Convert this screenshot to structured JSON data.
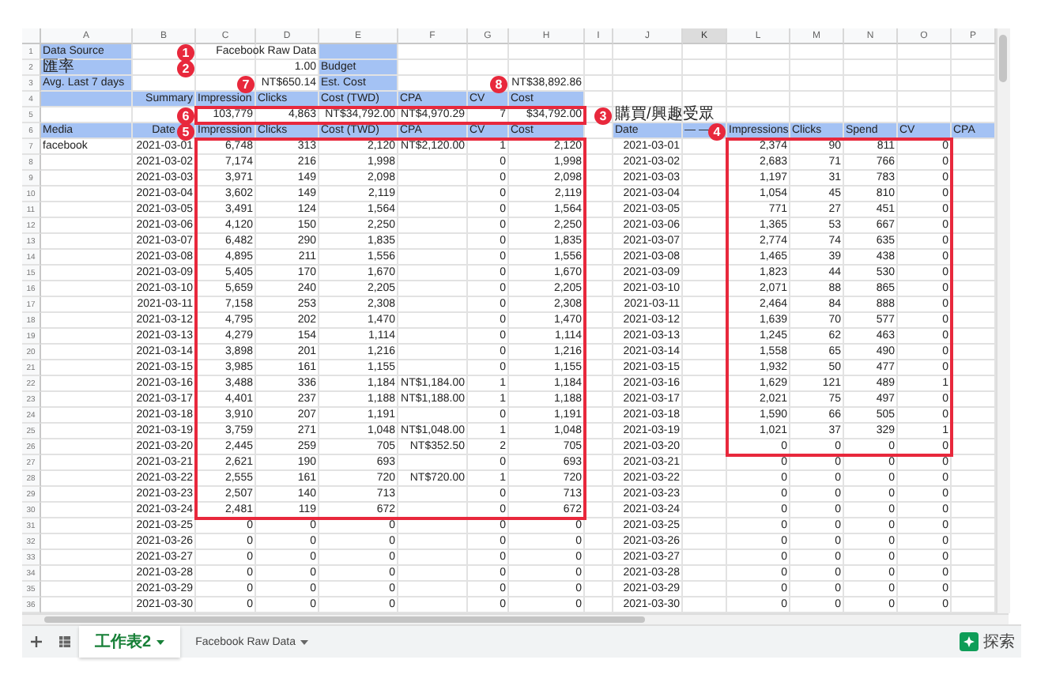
{
  "columns": [
    {
      "label": "A",
      "selected": false
    },
    {
      "label": "B",
      "selected": false
    },
    {
      "label": "C",
      "selected": false
    },
    {
      "label": "D",
      "selected": false
    },
    {
      "label": "E",
      "selected": false
    },
    {
      "label": "F",
      "selected": false
    },
    {
      "label": "G",
      "selected": false
    },
    {
      "label": "H",
      "selected": false
    },
    {
      "label": "I",
      "selected": false
    },
    {
      "label": "J",
      "selected": false
    },
    {
      "label": "K",
      "selected": true
    },
    {
      "label": "L",
      "selected": false
    },
    {
      "label": "M",
      "selected": false
    },
    {
      "label": "N",
      "selected": false
    },
    {
      "label": "O",
      "selected": false
    },
    {
      "label": "P",
      "selected": false
    }
  ],
  "rows": [
    {
      "number": "1",
      "kind": "label",
      "cells": {
        "A": "Data Source",
        "D": "Facebook Raw Data"
      }
    },
    {
      "number": "2",
      "kind": "label",
      "cells": {
        "A": "匯率",
        "D": "1.00",
        "E": "Budget"
      }
    },
    {
      "number": "3",
      "kind": "label",
      "cells": {
        "A": "Avg. Last 7 days",
        "D": "NT$650.14",
        "E": "Est. Cost",
        "H": "NT$38,892.86"
      }
    },
    {
      "number": "4",
      "kind": "summary",
      "cells": {
        "B": "Summary",
        "C": "Impression",
        "D": "Clicks",
        "E": "Cost (TWD)",
        "F": "CPA",
        "G": "CV",
        "H": "Cost"
      }
    },
    {
      "number": "5",
      "kind": "totals",
      "cells": {
        "C": "103,779",
        "D": "4,863",
        "E": "NT$34,792.00",
        "F": "NT$4,970.29",
        "G": "7",
        "H": "$34,792.00",
        "J": "購買/興趣受眾"
      }
    },
    {
      "number": "6",
      "kind": "header",
      "cells": {
        "A": "Media",
        "B": "Date",
        "C": "Impression",
        "D": "Clicks",
        "E": "Cost (TWD)",
        "F": "CPA",
        "G": "CV",
        "H": "Cost",
        "J": "Date",
        "K": "— —",
        "L": "Impressions",
        "M": "Clicks",
        "N": "Spend",
        "O": "CV",
        "P": "CPA"
      }
    },
    {
      "number": "7",
      "kind": "data",
      "cells": {
        "A": "facebook",
        "B": "2021-03-01",
        "C": "6,748",
        "D": "313",
        "E": "2,120",
        "F": "NT$2,120.00",
        "G": "1",
        "H": "2,120",
        "J": "2021-03-01",
        "L": "2,374",
        "M": "90",
        "N": "811",
        "O": "0"
      }
    },
    {
      "number": "8",
      "kind": "data",
      "cells": {
        "B": "2021-03-02",
        "C": "7,174",
        "D": "216",
        "E": "1,998",
        "G": "0",
        "H": "1,998",
        "J": "2021-03-02",
        "L": "2,683",
        "M": "71",
        "N": "766",
        "O": "0"
      }
    },
    {
      "number": "9",
      "kind": "data",
      "cells": {
        "B": "2021-03-03",
        "C": "3,971",
        "D": "149",
        "E": "2,098",
        "G": "0",
        "H": "2,098",
        "J": "2021-03-03",
        "L": "1,197",
        "M": "31",
        "N": "783",
        "O": "0"
      }
    },
    {
      "number": "10",
      "kind": "data",
      "cells": {
        "B": "2021-03-04",
        "C": "3,602",
        "D": "149",
        "E": "2,119",
        "G": "0",
        "H": "2,119",
        "J": "2021-03-04",
        "L": "1,054",
        "M": "45",
        "N": "810",
        "O": "0"
      }
    },
    {
      "number": "11",
      "kind": "data",
      "cells": {
        "B": "2021-03-05",
        "C": "3,491",
        "D": "124",
        "E": "1,564",
        "G": "0",
        "H": "1,564",
        "J": "2021-03-05",
        "L": "771",
        "M": "27",
        "N": "451",
        "O": "0"
      }
    },
    {
      "number": "12",
      "kind": "data",
      "cells": {
        "B": "2021-03-06",
        "C": "4,120",
        "D": "150",
        "E": "2,250",
        "G": "0",
        "H": "2,250",
        "J": "2021-03-06",
        "L": "1,365",
        "M": "53",
        "N": "667",
        "O": "0"
      }
    },
    {
      "number": "13",
      "kind": "data",
      "cells": {
        "B": "2021-03-07",
        "C": "6,482",
        "D": "290",
        "E": "1,835",
        "G": "0",
        "H": "1,835",
        "J": "2021-03-07",
        "L": "2,774",
        "M": "74",
        "N": "635",
        "O": "0"
      }
    },
    {
      "number": "14",
      "kind": "data",
      "cells": {
        "B": "2021-03-08",
        "C": "4,895",
        "D": "211",
        "E": "1,556",
        "G": "0",
        "H": "1,556",
        "J": "2021-03-08",
        "L": "1,465",
        "M": "39",
        "N": "438",
        "O": "0"
      }
    },
    {
      "number": "15",
      "kind": "data",
      "cells": {
        "B": "2021-03-09",
        "C": "5,405",
        "D": "170",
        "E": "1,670",
        "G": "0",
        "H": "1,670",
        "J": "2021-03-09",
        "L": "1,823",
        "M": "44",
        "N": "530",
        "O": "0"
      }
    },
    {
      "number": "16",
      "kind": "data",
      "cells": {
        "B": "2021-03-10",
        "C": "5,659",
        "D": "240",
        "E": "2,205",
        "G": "0",
        "H": "2,205",
        "J": "2021-03-10",
        "L": "2,071",
        "M": "88",
        "N": "865",
        "O": "0"
      }
    },
    {
      "number": "17",
      "kind": "data",
      "cells": {
        "B": "2021-03-11",
        "C": "7,158",
        "D": "253",
        "E": "2,308",
        "G": "0",
        "H": "2,308",
        "J": "2021-03-11",
        "L": "2,464",
        "M": "84",
        "N": "888",
        "O": "0"
      }
    },
    {
      "number": "18",
      "kind": "data",
      "cells": {
        "B": "2021-03-12",
        "C": "4,795",
        "D": "202",
        "E": "1,470",
        "G": "0",
        "H": "1,470",
        "J": "2021-03-12",
        "L": "1,639",
        "M": "70",
        "N": "577",
        "O": "0"
      }
    },
    {
      "number": "19",
      "kind": "data",
      "cells": {
        "B": "2021-03-13",
        "C": "4,279",
        "D": "154",
        "E": "1,114",
        "G": "0",
        "H": "1,114",
        "J": "2021-03-13",
        "L": "1,245",
        "M": "62",
        "N": "463",
        "O": "0"
      }
    },
    {
      "number": "20",
      "kind": "data",
      "cells": {
        "B": "2021-03-14",
        "C": "3,898",
        "D": "201",
        "E": "1,216",
        "G": "0",
        "H": "1,216",
        "J": "2021-03-14",
        "L": "1,558",
        "M": "65",
        "N": "490",
        "O": "0"
      }
    },
    {
      "number": "21",
      "kind": "data",
      "cells": {
        "B": "2021-03-15",
        "C": "3,985",
        "D": "161",
        "E": "1,155",
        "G": "0",
        "H": "1,155",
        "J": "2021-03-15",
        "L": "1,932",
        "M": "50",
        "N": "477",
        "O": "0"
      }
    },
    {
      "number": "22",
      "kind": "data",
      "cells": {
        "B": "2021-03-16",
        "C": "3,488",
        "D": "336",
        "E": "1,184",
        "F": "NT$1,184.00",
        "G": "1",
        "H": "1,184",
        "J": "2021-03-16",
        "L": "1,629",
        "M": "121",
        "N": "489",
        "O": "1"
      }
    },
    {
      "number": "23",
      "kind": "data",
      "cells": {
        "B": "2021-03-17",
        "C": "4,401",
        "D": "237",
        "E": "1,188",
        "F": "NT$1,188.00",
        "G": "1",
        "H": "1,188",
        "J": "2021-03-17",
        "L": "2,021",
        "M": "75",
        "N": "497",
        "O": "0"
      }
    },
    {
      "number": "24",
      "kind": "data",
      "cells": {
        "B": "2021-03-18",
        "C": "3,910",
        "D": "207",
        "E": "1,191",
        "G": "0",
        "H": "1,191",
        "J": "2021-03-18",
        "L": "1,590",
        "M": "66",
        "N": "505",
        "O": "0"
      }
    },
    {
      "number": "25",
      "kind": "data",
      "cells": {
        "B": "2021-03-19",
        "C": "3,759",
        "D": "271",
        "E": "1,048",
        "F": "NT$1,048.00",
        "G": "1",
        "H": "1,048",
        "J": "2021-03-19",
        "L": "1,021",
        "M": "37",
        "N": "329",
        "O": "1"
      }
    },
    {
      "number": "26",
      "kind": "data",
      "cells": {
        "B": "2021-03-20",
        "C": "2,445",
        "D": "259",
        "E": "705",
        "F": "NT$352.50",
        "G": "2",
        "H": "705",
        "J": "2021-03-20",
        "L": "0",
        "M": "0",
        "N": "0",
        "O": "0"
      }
    },
    {
      "number": "27",
      "kind": "data",
      "cells": {
        "B": "2021-03-21",
        "C": "2,621",
        "D": "190",
        "E": "693",
        "G": "0",
        "H": "693",
        "J": "2021-03-21",
        "L": "0",
        "M": "0",
        "N": "0",
        "O": "0"
      }
    },
    {
      "number": "28",
      "kind": "data",
      "cells": {
        "B": "2021-03-22",
        "C": "2,555",
        "D": "161",
        "E": "720",
        "F": "NT$720.00",
        "G": "1",
        "H": "720",
        "J": "2021-03-22",
        "L": "0",
        "M": "0",
        "N": "0",
        "O": "0"
      }
    },
    {
      "number": "29",
      "kind": "data",
      "cells": {
        "B": "2021-03-23",
        "C": "2,507",
        "D": "140",
        "E": "713",
        "G": "0",
        "H": "713",
        "J": "2021-03-23",
        "L": "0",
        "M": "0",
        "N": "0",
        "O": "0"
      }
    },
    {
      "number": "30",
      "kind": "data",
      "cells": {
        "B": "2021-03-24",
        "C": "2,481",
        "D": "119",
        "E": "672",
        "G": "0",
        "H": "672",
        "J": "2021-03-24",
        "L": "0",
        "M": "0",
        "N": "0",
        "O": "0"
      }
    },
    {
      "number": "31",
      "kind": "data",
      "cells": {
        "B": "2021-03-25",
        "C": "0",
        "D": "0",
        "E": "0",
        "G": "0",
        "H": "0",
        "J": "2021-03-25",
        "L": "0",
        "M": "0",
        "N": "0",
        "O": "0"
      }
    },
    {
      "number": "32",
      "kind": "data",
      "cells": {
        "B": "2021-03-26",
        "C": "0",
        "D": "0",
        "E": "0",
        "G": "0",
        "H": "0",
        "J": "2021-03-26",
        "L": "0",
        "M": "0",
        "N": "0",
        "O": "0"
      }
    },
    {
      "number": "33",
      "kind": "data",
      "cells": {
        "B": "2021-03-27",
        "C": "0",
        "D": "0",
        "E": "0",
        "G": "0",
        "H": "0",
        "J": "2021-03-27",
        "L": "0",
        "M": "0",
        "N": "0",
        "O": "0"
      }
    },
    {
      "number": "34",
      "kind": "data",
      "cells": {
        "B": "2021-03-28",
        "C": "0",
        "D": "0",
        "E": "0",
        "G": "0",
        "H": "0",
        "J": "2021-03-28",
        "L": "0",
        "M": "0",
        "N": "0",
        "O": "0"
      }
    },
    {
      "number": "35",
      "kind": "data",
      "cells": {
        "B": "2021-03-29",
        "C": "0",
        "D": "0",
        "E": "0",
        "G": "0",
        "H": "0",
        "J": "2021-03-29",
        "L": "0",
        "M": "0",
        "N": "0",
        "O": "0"
      }
    },
    {
      "number": "36",
      "kind": "data",
      "cells": {
        "B": "2021-03-30",
        "C": "0",
        "D": "0",
        "E": "0",
        "G": "0",
        "H": "0",
        "J": "2021-03-30",
        "L": "0",
        "M": "0",
        "N": "0",
        "O": "0"
      }
    }
  ],
  "annotations": {
    "markers": {
      "B1": "1",
      "B2": "2",
      "C3": "7",
      "G3": "8",
      "B5": "6",
      "I5": "3",
      "B6": "5",
      "K6": "4"
    },
    "frames": {
      "C5:H5": true,
      "C7:H30": true,
      "L7:O26": true
    }
  },
  "sheet_tabs": [
    {
      "label": "工作表2",
      "selected": true
    },
    {
      "label": "Facebook Raw Data",
      "selected": false
    }
  ],
  "explore_button": {
    "label": "探索"
  }
}
